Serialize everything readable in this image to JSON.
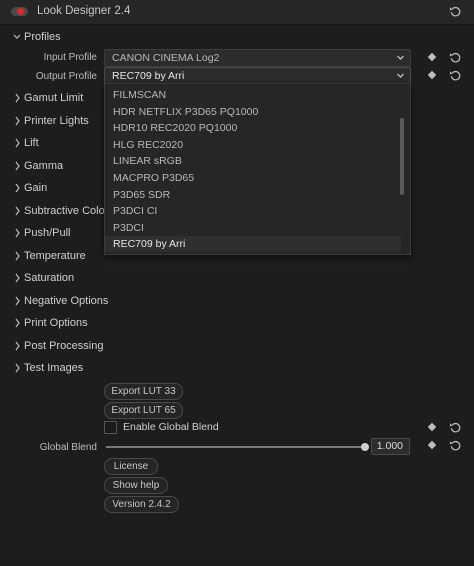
{
  "window": {
    "title": "Look Designer 2.4",
    "enabled": true
  },
  "profiles": {
    "section_label": "Profiles",
    "input_label": "Input Profile",
    "input_value": "CANON CINEMA Log2",
    "output_label": "Output Profile",
    "output_value": "REC709 by Arri",
    "dropdown_options": [
      "FILMSCAN",
      "HDR NETFLIX P3D65 PQ1000",
      "HDR10 REC2020 PQ1000",
      "HLG REC2020",
      "LINEAR sRGB",
      "MACPRO P3D65",
      "P3D65 SDR",
      "P3DCI CI",
      "P3DCI",
      "REC709 by Arri"
    ],
    "selected_option": "REC709 by Arri"
  },
  "sections": [
    "Gamut Limit",
    "Printer Lights",
    "Lift",
    "Gamma",
    "Gain",
    "Subtractive Color",
    "Push/Pull",
    "Temperature",
    "Saturation",
    "Negative Options",
    "Print Options",
    "Post Processing",
    "Test Images"
  ],
  "buttons": {
    "export_lut_33": "Export LUT 33",
    "export_lut_65": "Export LUT 65",
    "license": "License",
    "show_help": "Show help",
    "version": "Version 2.4.2"
  },
  "global_blend": {
    "enable_label": "Enable Global Blend",
    "enabled": false,
    "label": "Global Blend",
    "value": "1.000",
    "fraction": 1.0
  },
  "colors": {
    "background": "#1d1d1f",
    "accent_red": "#e0262b",
    "text": "#c9c9c9"
  },
  "icons": {
    "reset": "reset-icon",
    "keyframe": "keyframe-diamond-icon",
    "chevron_right": "chevron-right-icon",
    "chevron_down": "chevron-down-icon"
  }
}
